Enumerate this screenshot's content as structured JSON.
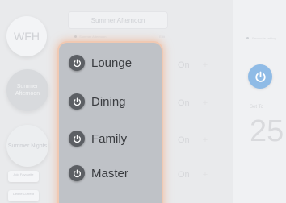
{
  "scenes": {
    "wfh": "WFH",
    "summer_afternoon": "Summer Afternoon",
    "summer_nights": "Summer Nights",
    "mini_button_1": "Add Favourite",
    "mini_button_2": "Delete Current"
  },
  "scene_name_field": {
    "value": "Summer Afternoon"
  },
  "scene_meta": {
    "left": "Summer Afternoon",
    "right": "Edit"
  },
  "rooms": [
    {
      "label": "Lounge"
    },
    {
      "label": "Dining"
    },
    {
      "label": "Family"
    },
    {
      "label": "Master"
    }
  ],
  "toggles": {
    "state_label": "On",
    "plus_symbol": "+"
  },
  "right_panel": {
    "label": "Favourite setting",
    "set_to_label": "Set To",
    "setpoint": "25"
  },
  "colors": {
    "panel_bg": "#bfc2c7",
    "highlight": "#f0c9b3",
    "power_blue": "#8fbbe6",
    "power_dark": "#5c5f64"
  }
}
